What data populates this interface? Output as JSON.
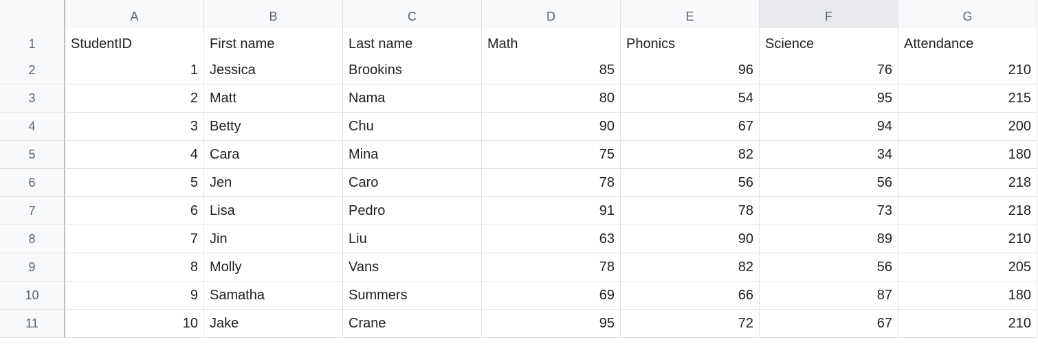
{
  "columns": [
    "A",
    "B",
    "C",
    "D",
    "E",
    "F",
    "G"
  ],
  "columns_highlight": [
    false,
    false,
    false,
    false,
    false,
    true,
    false
  ],
  "headers": [
    "StudentID",
    "First name",
    "Last name",
    "Math",
    "Phonics",
    "Science",
    "Attendance"
  ],
  "rows": [
    {
      "n": 1,
      "id": 1,
      "first": "Jessica",
      "last": "Brookins",
      "math": 85,
      "phonics": 96,
      "science": 76,
      "attendance": 210
    },
    {
      "n": 2,
      "id": 2,
      "first": "Matt",
      "last": "Nama",
      "math": 80,
      "phonics": 54,
      "science": 95,
      "attendance": 215
    },
    {
      "n": 3,
      "id": 3,
      "first": "Betty",
      "last": "Chu",
      "math": 90,
      "phonics": 67,
      "science": 94,
      "attendance": 200
    },
    {
      "n": 4,
      "id": 4,
      "first": "Cara",
      "last": "Mina",
      "math": 75,
      "phonics": 82,
      "science": 34,
      "attendance": 180
    },
    {
      "n": 5,
      "id": 5,
      "first": "Jen",
      "last": "Caro",
      "math": 78,
      "phonics": 56,
      "science": 56,
      "attendance": 218
    },
    {
      "n": 6,
      "id": 6,
      "first": "Lisa",
      "last": "Pedro",
      "math": 91,
      "phonics": 78,
      "science": 73,
      "attendance": 218
    },
    {
      "n": 7,
      "id": 7,
      "first": "Jin",
      "last": "Liu",
      "math": 63,
      "phonics": 90,
      "science": 89,
      "attendance": 210
    },
    {
      "n": 8,
      "id": 8,
      "first": "Molly",
      "last": "Vans",
      "math": 78,
      "phonics": 82,
      "science": 56,
      "attendance": 205
    },
    {
      "n": 9,
      "id": 9,
      "first": "Samatha",
      "last": "Summers",
      "math": 69,
      "phonics": 66,
      "science": 87,
      "attendance": 180
    },
    {
      "n": 10,
      "id": 10,
      "first": "Jake",
      "last": "Crane",
      "math": 95,
      "phonics": 72,
      "science": 67,
      "attendance": 210
    }
  ]
}
